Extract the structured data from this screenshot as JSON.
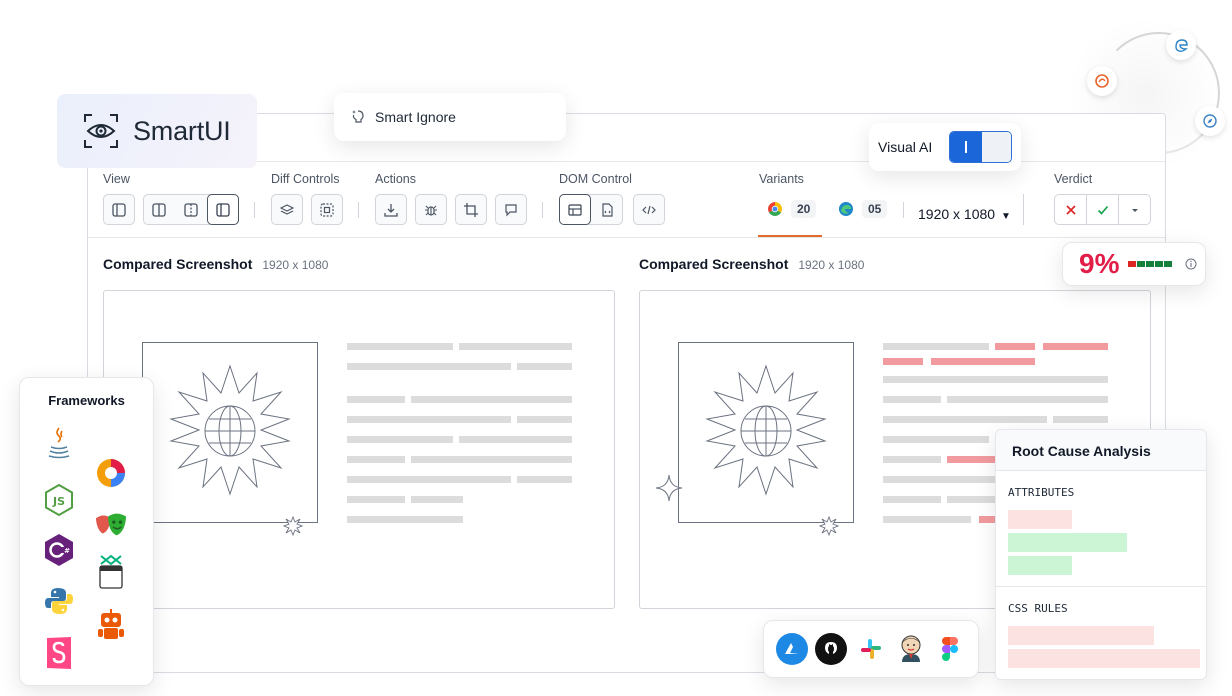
{
  "brand": {
    "name": "SmartUI"
  },
  "smart_ignore": {
    "label": "Smart Ignore"
  },
  "visual_ai": {
    "label": "Visual AI",
    "enabled": true
  },
  "toolbar": {
    "view_label": "View",
    "diff_controls_label": "Diff Controls",
    "actions_label": "Actions",
    "dom_control_label": "DOM Control",
    "variants_label": "Variants",
    "verdict_label": "Verdict"
  },
  "variants": [
    {
      "browser": "chrome-icon",
      "count": "20",
      "active": true
    },
    {
      "browser": "edge-icon",
      "count": "05",
      "active": false
    }
  ],
  "resolution": {
    "value": "1920 x 1080"
  },
  "mismatch": {
    "percent": "9%"
  },
  "panes": [
    {
      "title": "Compared Screenshot",
      "dimensions": "1920 x 1080"
    },
    {
      "title": "Compared Screenshot",
      "dimensions": "1920 x 1080"
    }
  ],
  "frameworks": {
    "title": "Frameworks",
    "icons": [
      "java-icon",
      "cypress-icon",
      "nodejs-icon",
      "playwright-icon",
      "csharp-icon",
      "puppeteer-icon",
      "python-icon",
      "webdriverio-robot-icon",
      "storybook-icon"
    ]
  },
  "integrations": [
    "azure-devops-icon",
    "github-icon",
    "slack-icon",
    "jenkins-icon",
    "figma-icon"
  ],
  "root_cause": {
    "title": "Root Cause Analysis",
    "attributes_label": "ATTRIBUTES",
    "css_rules_label": "CSS RULES"
  },
  "colors": {
    "accent_blue": "#1b67da",
    "mismatch_red": "#e11d48",
    "diff_red": "#f29b9f",
    "added_green": "#ccf5d6",
    "removed_red": "#fde2e2"
  }
}
